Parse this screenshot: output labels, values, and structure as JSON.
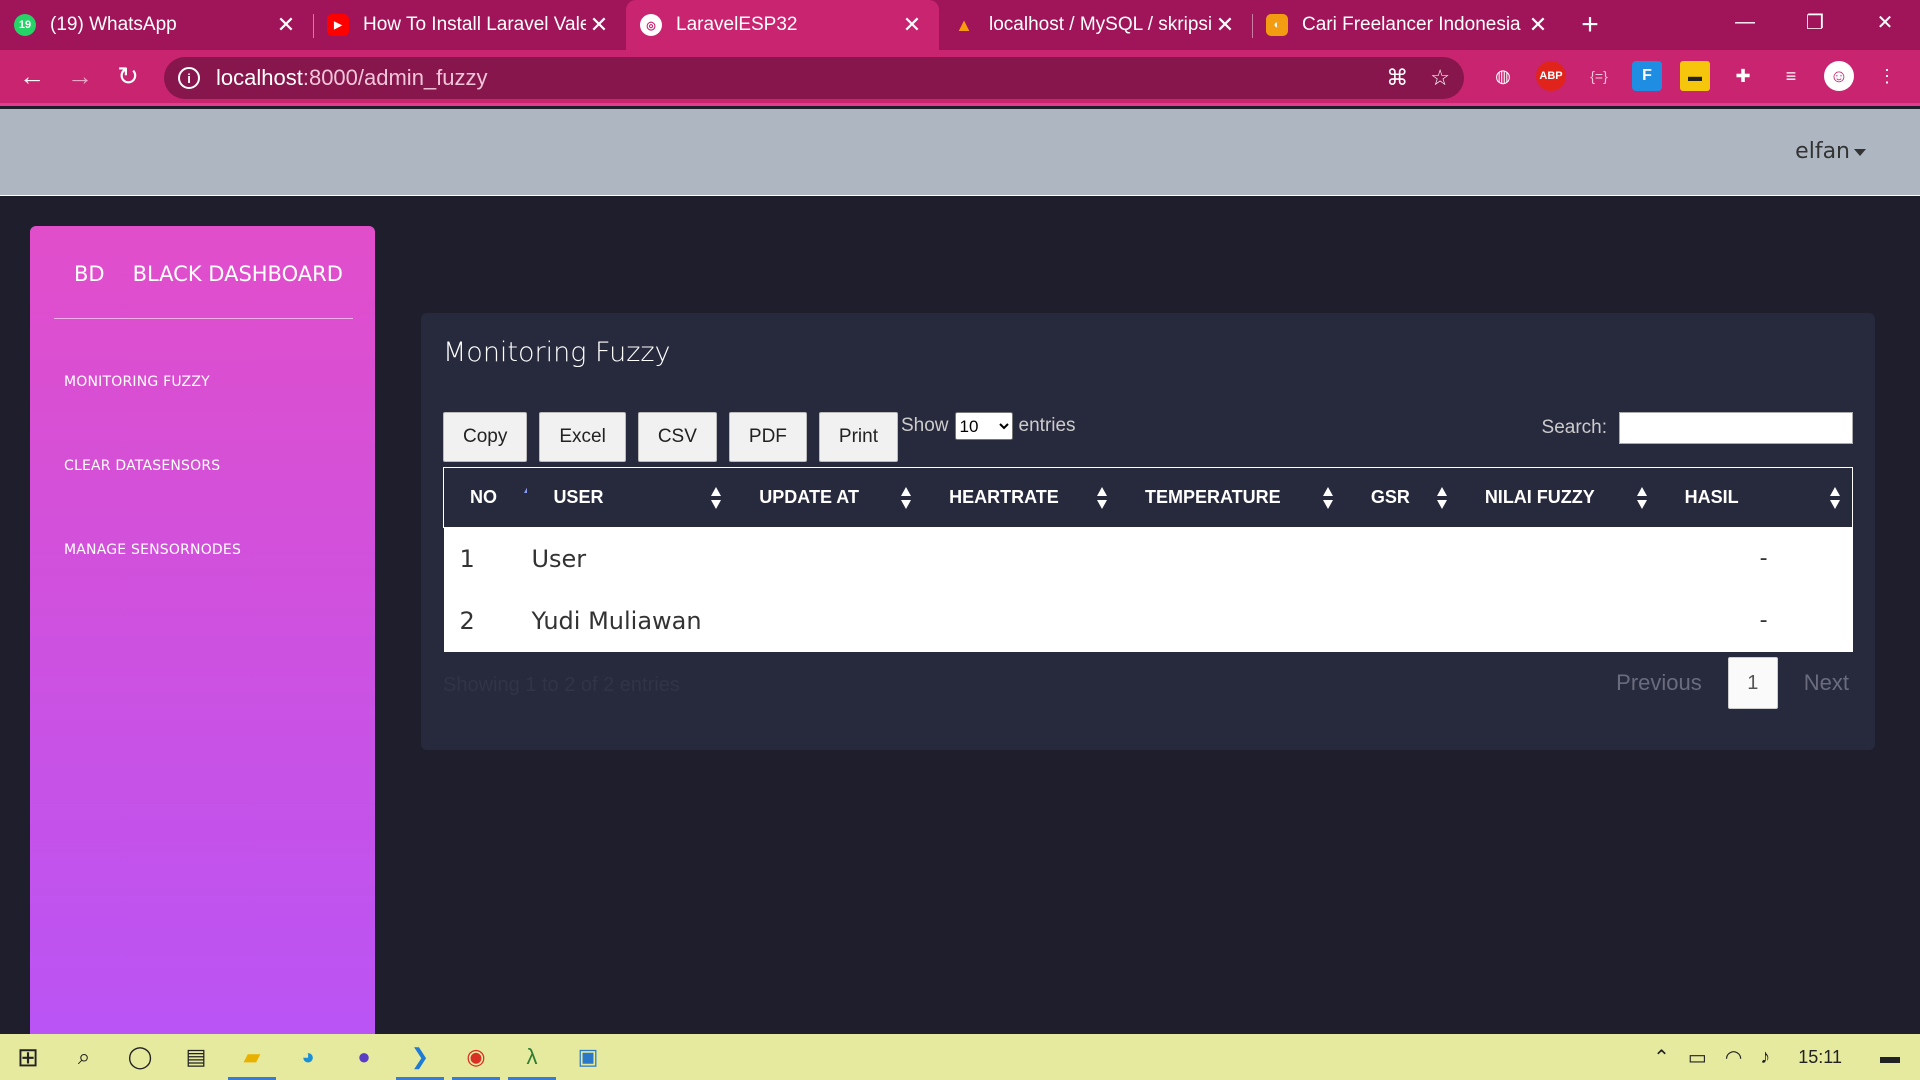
{
  "browser": {
    "tabs": [
      {
        "title": "(19) WhatsApp",
        "badge": "19",
        "icon": "whatsapp-icon",
        "color": "#25d366",
        "active": false
      },
      {
        "title": "How To Install Laravel Valet",
        "badge": "",
        "icon": "youtube-icon",
        "color": "#ff0000",
        "active": false
      },
      {
        "title": "LaravelESP32",
        "badge": "",
        "icon": "globe-icon",
        "color": "#ffffff",
        "active": true
      },
      {
        "title": "localhost / MySQL / skripsil",
        "badge": "",
        "icon": "phpmyadmin-icon",
        "color": "#f89c0e",
        "active": false
      },
      {
        "title": "Cari Freelancer Indonesia d",
        "badge": "",
        "icon": "freelancer-icon",
        "color": "#f39c12",
        "active": false
      }
    ],
    "url_host": "localhost",
    "url_path": ":8000/admin_fuzzy"
  },
  "header": {
    "user": "elfan"
  },
  "sidebar": {
    "brand_mini": "BD",
    "brand_name": "BLACK DASHBOARD",
    "items": [
      {
        "label": "MONITORING FUZZY"
      },
      {
        "label": "CLEAR DATASENSORS"
      },
      {
        "label": "MANAGE SENSORNODES"
      }
    ]
  },
  "card": {
    "title": "Monitoring Fuzzy",
    "buttons": [
      "Copy",
      "Excel",
      "CSV",
      "PDF",
      "Print"
    ],
    "show_label": "Show",
    "entries_label": "entries",
    "page_length": "10",
    "search_label": "Search:",
    "columns": [
      "NO",
      "USER",
      "UPDATE AT",
      "HEARTRATE",
      "TEMPERATURE",
      "GSR",
      "NILAI FUZZY",
      "HASIL"
    ],
    "rows": [
      {
        "no": "1",
        "user": "User",
        "update_at": "",
        "heartrate": "",
        "temperature": "",
        "gsr": "",
        "nilai_fuzzy": "",
        "hasil": "-"
      },
      {
        "no": "2",
        "user": "Yudi Muliawan",
        "update_at": "",
        "heartrate": "",
        "temperature": "",
        "gsr": "",
        "nilai_fuzzy": "",
        "hasil": "-"
      }
    ],
    "info": "Showing 1 to 2 of 2 entries",
    "pager": {
      "previous": "Previous",
      "page": "1",
      "next": "Next"
    }
  },
  "taskbar": {
    "clock": "15:11"
  }
}
